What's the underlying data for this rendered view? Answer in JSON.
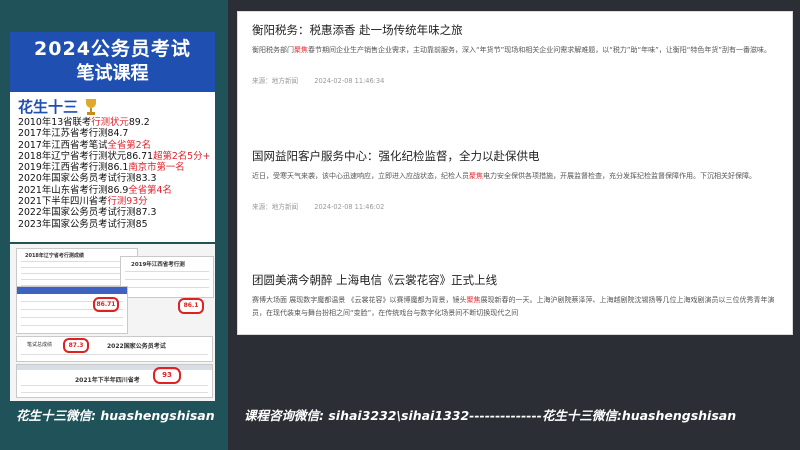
{
  "left_panel": {
    "promo": {
      "year_title": "2024公务员考试",
      "course_title": "笔试课程",
      "name": "花生十三",
      "achievements": [
        {
          "text": "2010年13省联考",
          "highlight": "行测状元",
          "suffix": "89.2"
        },
        {
          "text": "2017年江苏省考行测84.7",
          "highlight": "",
          "suffix": ""
        },
        {
          "text": "2017年江西省考笔试",
          "highlight": "全省第2名",
          "suffix": ""
        },
        {
          "text": "2018年辽宁省考行测状元86.71",
          "highlight": "超第2名5分+",
          "suffix": ""
        },
        {
          "text": "2019年江西省考行测86.1",
          "highlight": "南京市第一名",
          "suffix": ""
        },
        {
          "text": "2020年国家公务员考试行测83.3",
          "highlight": "",
          "suffix": ""
        },
        {
          "text": "2021年山东省考行测86.9",
          "highlight": "全省第4名",
          "suffix": ""
        },
        {
          "text": "2021下半年四川省考",
          "highlight": "行测93分",
          "suffix": ""
        },
        {
          "text": "2022年国家公务员考试行测87.3",
          "highlight": "",
          "suffix": ""
        },
        {
          "text": "2023年国家公务员考试行测85",
          "highlight": "",
          "suffix": ""
        }
      ]
    },
    "score_docs": {
      "doc1_title": "2018年辽宁省考行测成绩",
      "doc2_title": "2019年江西省考行测",
      "doc1_score": "86.71",
      "doc2_score": "86.1",
      "doc3_label": "笔试总成绩",
      "doc3_score": "87.3",
      "doc3_title": "2022国家公务员考试",
      "doc4_score": "93",
      "doc4_title": "2021年下半年四川省考"
    },
    "wechat_caption": "花生十三微信: huashengshisan"
  },
  "bottom_caption": "课程咨询微信: sihai3232\\sihai1332--------------花生十三微信:huashengshisan",
  "news": [
    {
      "title": "衡阳税务：税惠添香 赴一场传统年味之旅",
      "body_parts": [
        {
          "text": "衡阳税务部门",
          "kw": false
        },
        {
          "text": "聚焦",
          "kw": true
        },
        {
          "text": "春节期间企业生产销售企业需求，主动靠前服务，深入“年货节”现场和相关企业问需求解难题，以“税力”助“年味”，让衡阳“特色年货”刮有一番滋味。",
          "kw": false
        }
      ],
      "source": "来源：地方新闻",
      "time": "2024-02-08 11:46:34"
    },
    {
      "title": "国网益阳客户服务中心：强化纪检监督，全力以赴保供电",
      "body_parts": [
        {
          "text": "近日，受寒天气来袭，该中心迅速响应，立即进入应战状态，纪检人员",
          "kw": false
        },
        {
          "text": "聚焦",
          "kw": true
        },
        {
          "text": "电力安全保供各项措施，开展监督检查，充分发挥纪检监督保障作用。下沉相关好保障。",
          "kw": false
        }
      ],
      "source": "来源：地方新闻",
      "time": "2024-02-08 11:46:02"
    },
    {
      "title": "团圆美满今朝醉 上海电信《云裳花容》正式上线",
      "body_parts": [
        {
          "text": "赛博大场面 展现数字魔都温景 《云裳花容》以赛博魔都为背景，镜头",
          "kw": false
        },
        {
          "text": "聚焦",
          "kw": true
        },
        {
          "text": "展现新春的一天。上海沪剧院蔡泽萍、上海越剧院沈锡扬等几位上海戏剧演员以三位优秀青年演员，在现代装束与舞台扮相之间“变脸”，在传统戏台与数字化场景间不断切换现代之间",
          "kw": false
        }
      ],
      "source": "",
      "time": ""
    }
  ],
  "colors": {
    "left_bg": "#1f5259",
    "header_blue": "#1f4fb0",
    "highlight_red": "#e0212b",
    "page_bg": "#2b2f35"
  }
}
